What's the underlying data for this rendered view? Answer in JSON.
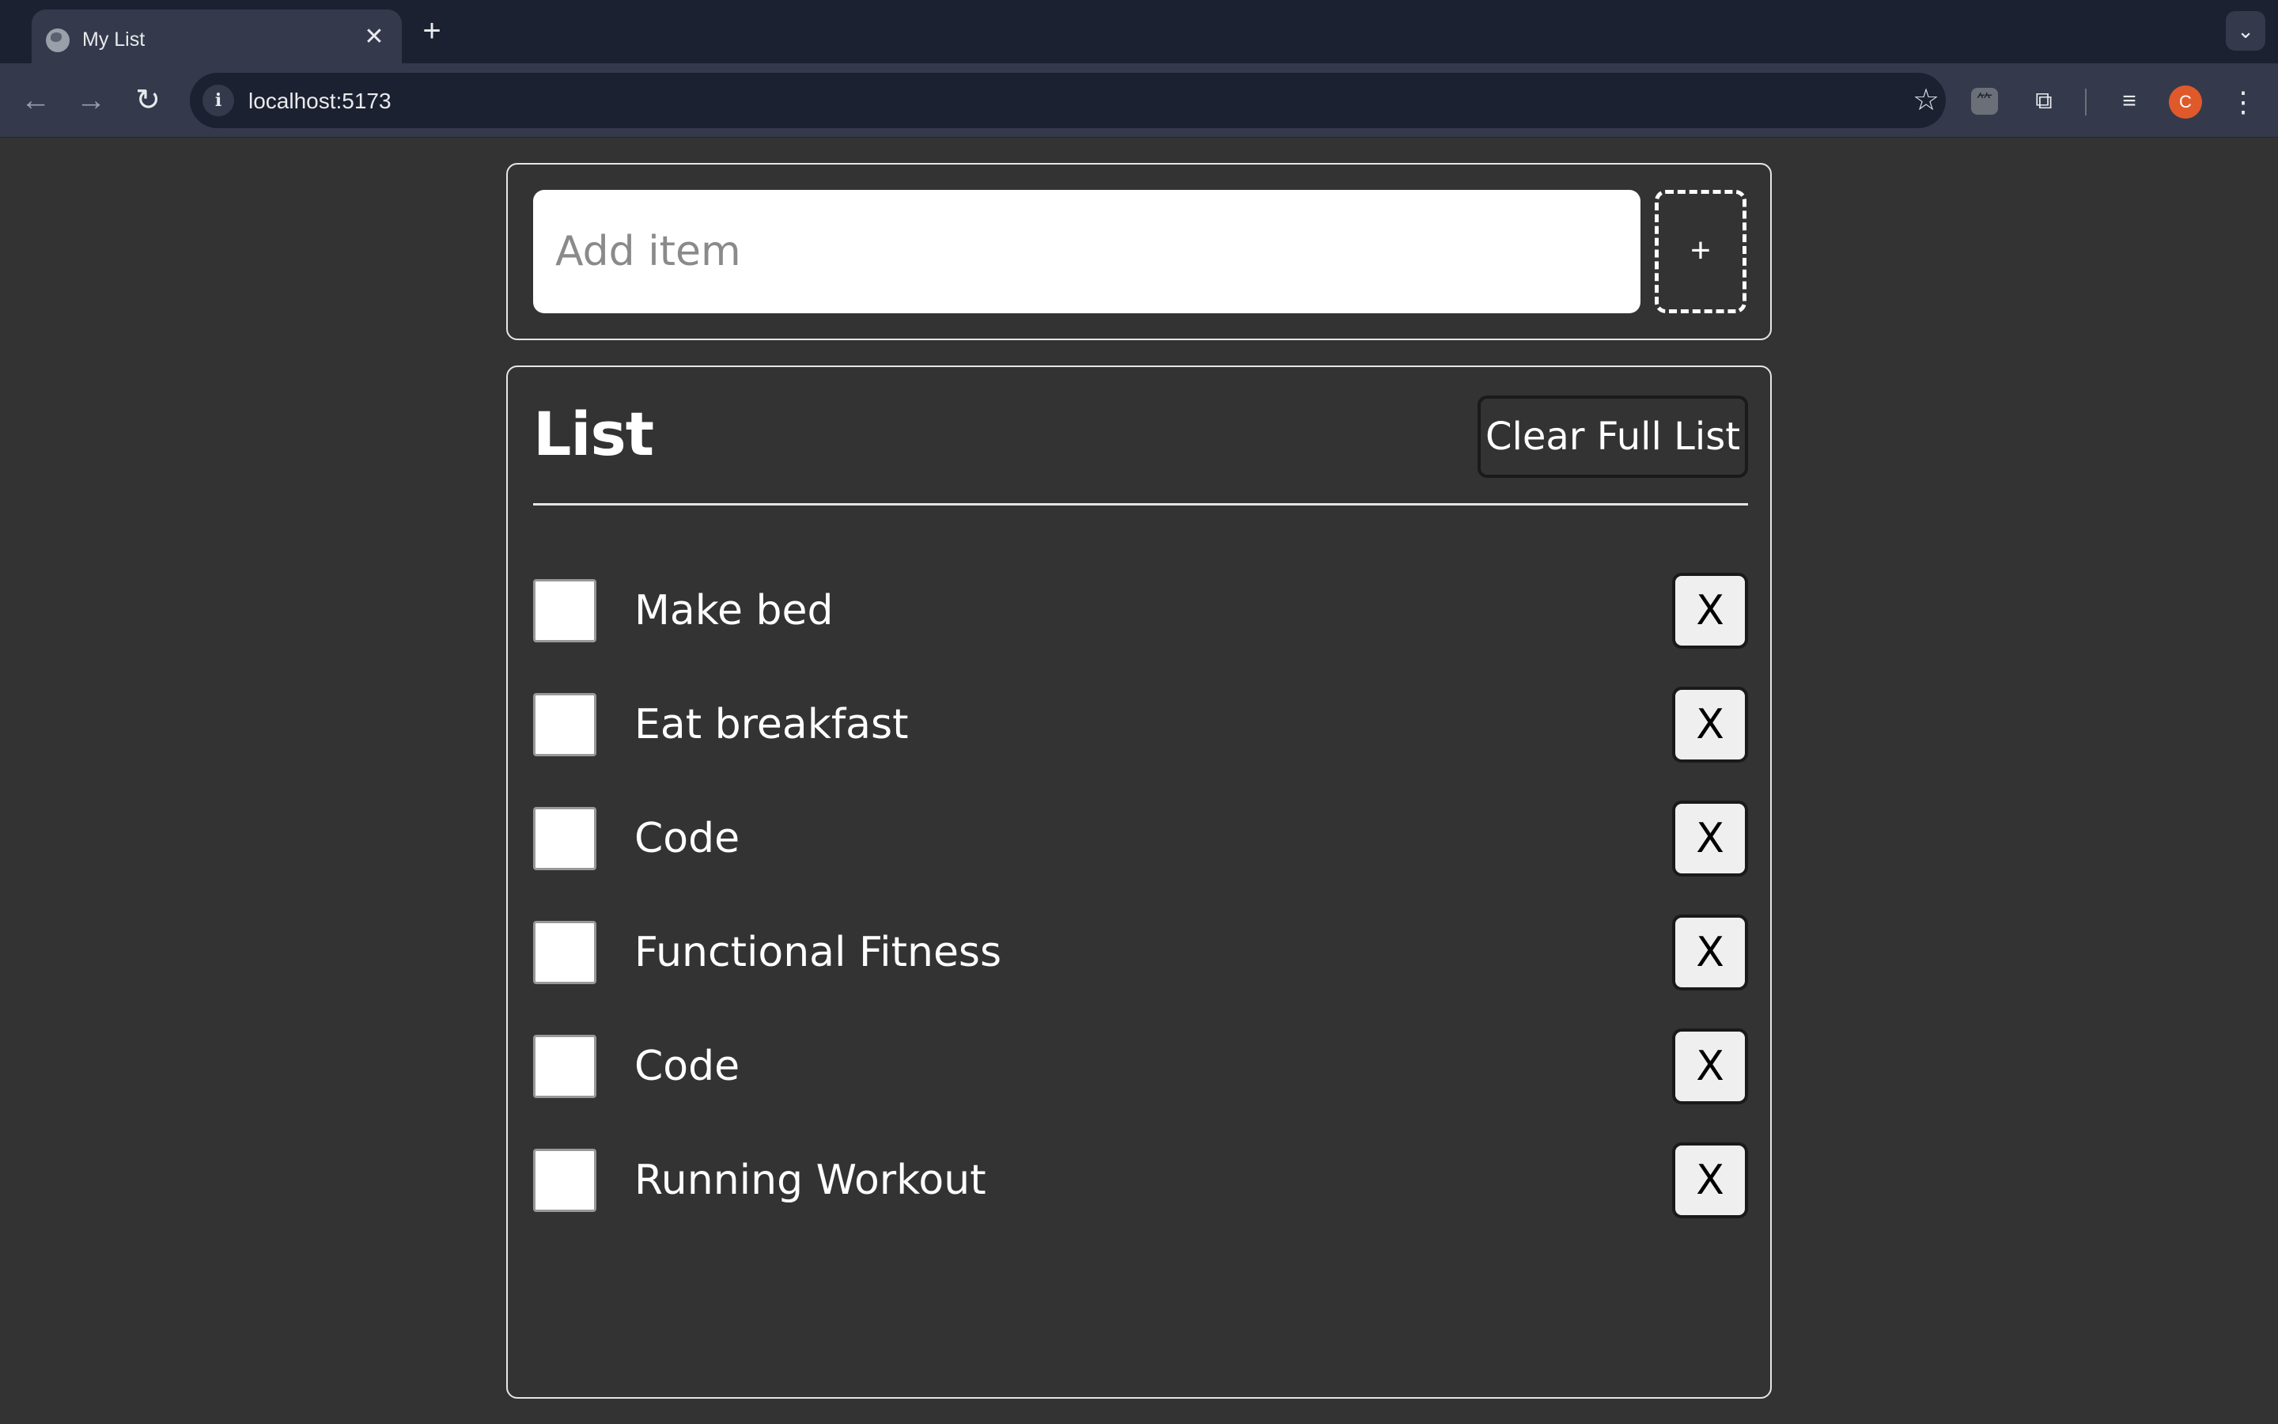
{
  "browser": {
    "tab_title": "My List",
    "tab_close": "✕",
    "new_tab": "+",
    "tab_search": "⌄",
    "back": "←",
    "forward": "→",
    "reload": "↻",
    "url": "localhost:5173",
    "bookmark": "☆",
    "extensions": "⧉",
    "avatar_letter": "C",
    "menu": "⋮",
    "media": "≡",
    "icons": {
      "favicon": "globe-icon",
      "site_info": "info-icon",
      "bookmark": "star-icon",
      "translate_ext": "translate-icon",
      "extensions": "puzzle-icon",
      "media": "media-control-icon",
      "menu": "kebab-menu-icon"
    },
    "colors": {
      "tabbar": "#1c2131",
      "toolbar": "#343a4b",
      "avatar": "#e0592a"
    }
  },
  "add_form": {
    "placeholder": "Add item",
    "value": "",
    "add_label": "+"
  },
  "list": {
    "title": "List",
    "clear_label": "Clear Full List",
    "remove_label": "X",
    "items": [
      {
        "label": "Make bed",
        "checked": false
      },
      {
        "label": "Eat breakfast",
        "checked": false
      },
      {
        "label": "Code",
        "checked": false
      },
      {
        "label": "Functional Fitness",
        "checked": false
      },
      {
        "label": "Code",
        "checked": false
      },
      {
        "label": "Running Workout",
        "checked": false
      }
    ]
  },
  "colors": {
    "page_background": "#333333",
    "card_border": "#e6e6e6",
    "text": "#ffffff"
  }
}
